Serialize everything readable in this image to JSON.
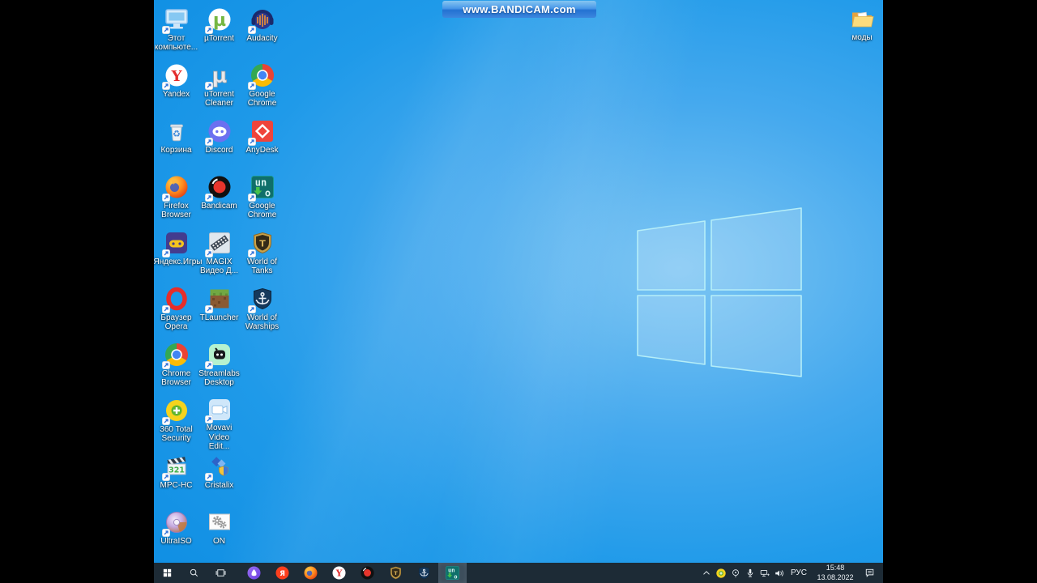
{
  "watermark": {
    "text": "www.BANDICAM.com"
  },
  "desktop": {
    "icons": [
      {
        "name": "this-pc",
        "label": "Этот компьюте...",
        "kind": "monitor",
        "shortcut": true
      },
      {
        "name": "utorrent",
        "label": "µTorrent",
        "kind": "utorrent",
        "shortcut": true
      },
      {
        "name": "audacity",
        "label": "Audacity",
        "kind": "audacity",
        "shortcut": true
      },
      {
        "name": "yandex",
        "label": "Yandex",
        "kind": "yandex",
        "shortcut": true
      },
      {
        "name": "utorrent-cleaner",
        "label": "uTorrent Cleaner",
        "kind": "utcleaner",
        "shortcut": true
      },
      {
        "name": "google-chrome",
        "label": "Google Chrome",
        "kind": "chrome",
        "shortcut": true
      },
      {
        "name": "recycle-bin",
        "label": "Корзина",
        "kind": "recycle",
        "shortcut": false
      },
      {
        "name": "discord",
        "label": "Discord",
        "kind": "discord",
        "shortcut": true
      },
      {
        "name": "anydesk",
        "label": "AnyDesk",
        "kind": "anydesk",
        "shortcut": true
      },
      {
        "name": "firefox-browser",
        "label": "Firefox Browser",
        "kind": "firefox",
        "shortcut": true
      },
      {
        "name": "bandicam",
        "label": "Bandicam",
        "kind": "bandicam",
        "shortcut": true
      },
      {
        "name": "uno-google-chrome",
        "label": "Google Chrome",
        "kind": "uno",
        "shortcut": true
      },
      {
        "name": "yandex-games",
        "label": "Яндекс.Игры",
        "kind": "yagames",
        "shortcut": true
      },
      {
        "name": "magix-video",
        "label": "MAGIX Видео Д...",
        "kind": "magix",
        "shortcut": true
      },
      {
        "name": "world-of-tanks",
        "label": "World of Tanks",
        "kind": "wot",
        "shortcut": true
      },
      {
        "name": "opera-browser",
        "label": "Браузер Opera",
        "kind": "opera",
        "shortcut": true
      },
      {
        "name": "tlauncher",
        "label": "TLauncher",
        "kind": "tlauncher",
        "shortcut": true
      },
      {
        "name": "world-of-warships",
        "label": "World of Warships",
        "kind": "wows",
        "shortcut": true
      },
      {
        "name": "chrome-browser",
        "label": "Chrome Browser",
        "kind": "chrome",
        "shortcut": true
      },
      {
        "name": "streamlabs-desktop",
        "label": "Streamlabs Desktop",
        "kind": "streamlabs",
        "shortcut": true
      },
      {
        "name": "360-total-security",
        "label": "360 Total Security",
        "kind": "t360",
        "shortcut": true
      },
      {
        "name": "movavi-video-editor",
        "label": "Movavi Video Edit...",
        "kind": "movavi",
        "shortcut": true
      },
      {
        "name": "mpc-hc",
        "label": "MPC-HC",
        "kind": "mpchc",
        "shortcut": true
      },
      {
        "name": "cristalix",
        "label": "Cristalix",
        "kind": "cristalix",
        "shortcut": true
      },
      {
        "name": "ultraiso",
        "label": "UltraISO",
        "kind": "ultraiso",
        "shortcut": true
      },
      {
        "name": "on",
        "label": "ON",
        "kind": "gears",
        "shortcut": false
      }
    ],
    "folder": {
      "name": "mody-folder",
      "label": "моды",
      "kind": "folder"
    }
  },
  "taskbar": {
    "system": [
      {
        "name": "start-button",
        "kind": "start"
      },
      {
        "name": "search-button",
        "kind": "search"
      },
      {
        "name": "task-view-button",
        "kind": "taskview"
      }
    ],
    "apps": [
      {
        "name": "yandex-alice",
        "kind": "alice",
        "active": false
      },
      {
        "name": "yandex-browser",
        "kind": "yabrowser",
        "active": false
      },
      {
        "name": "firefox",
        "kind": "firefox",
        "active": false
      },
      {
        "name": "yandex",
        "kind": "yandex",
        "active": false
      },
      {
        "name": "bandicam",
        "kind": "bandicam",
        "active": false
      },
      {
        "name": "world-of-tanks",
        "kind": "wot",
        "active": false
      },
      {
        "name": "world-of-warships",
        "kind": "wows",
        "active": false
      },
      {
        "name": "uno",
        "kind": "uno",
        "active": true
      }
    ],
    "tray": {
      "icons": [
        {
          "name": "tray-expand-chevron",
          "kind": "chevron"
        },
        {
          "name": "360-security-tray",
          "kind": "t360"
        },
        {
          "name": "recorder-tray",
          "kind": "trayrec"
        },
        {
          "name": "microphone-tray",
          "kind": "mic"
        },
        {
          "name": "network-tray",
          "kind": "net"
        },
        {
          "name": "volume-tray",
          "kind": "vol"
        }
      ],
      "language": "РУС",
      "time": "15:48",
      "date": "13.08.2022",
      "action": {
        "name": "action-center-button",
        "kind": "action"
      }
    }
  },
  "colors": {
    "taskbar_bg": "#1d2b36",
    "taskbar_active_bg": "#3d4e5c",
    "wallpaper_main": "#1495e8",
    "watermark_blue": "#2f86e6",
    "letterbox": "#000000"
  }
}
